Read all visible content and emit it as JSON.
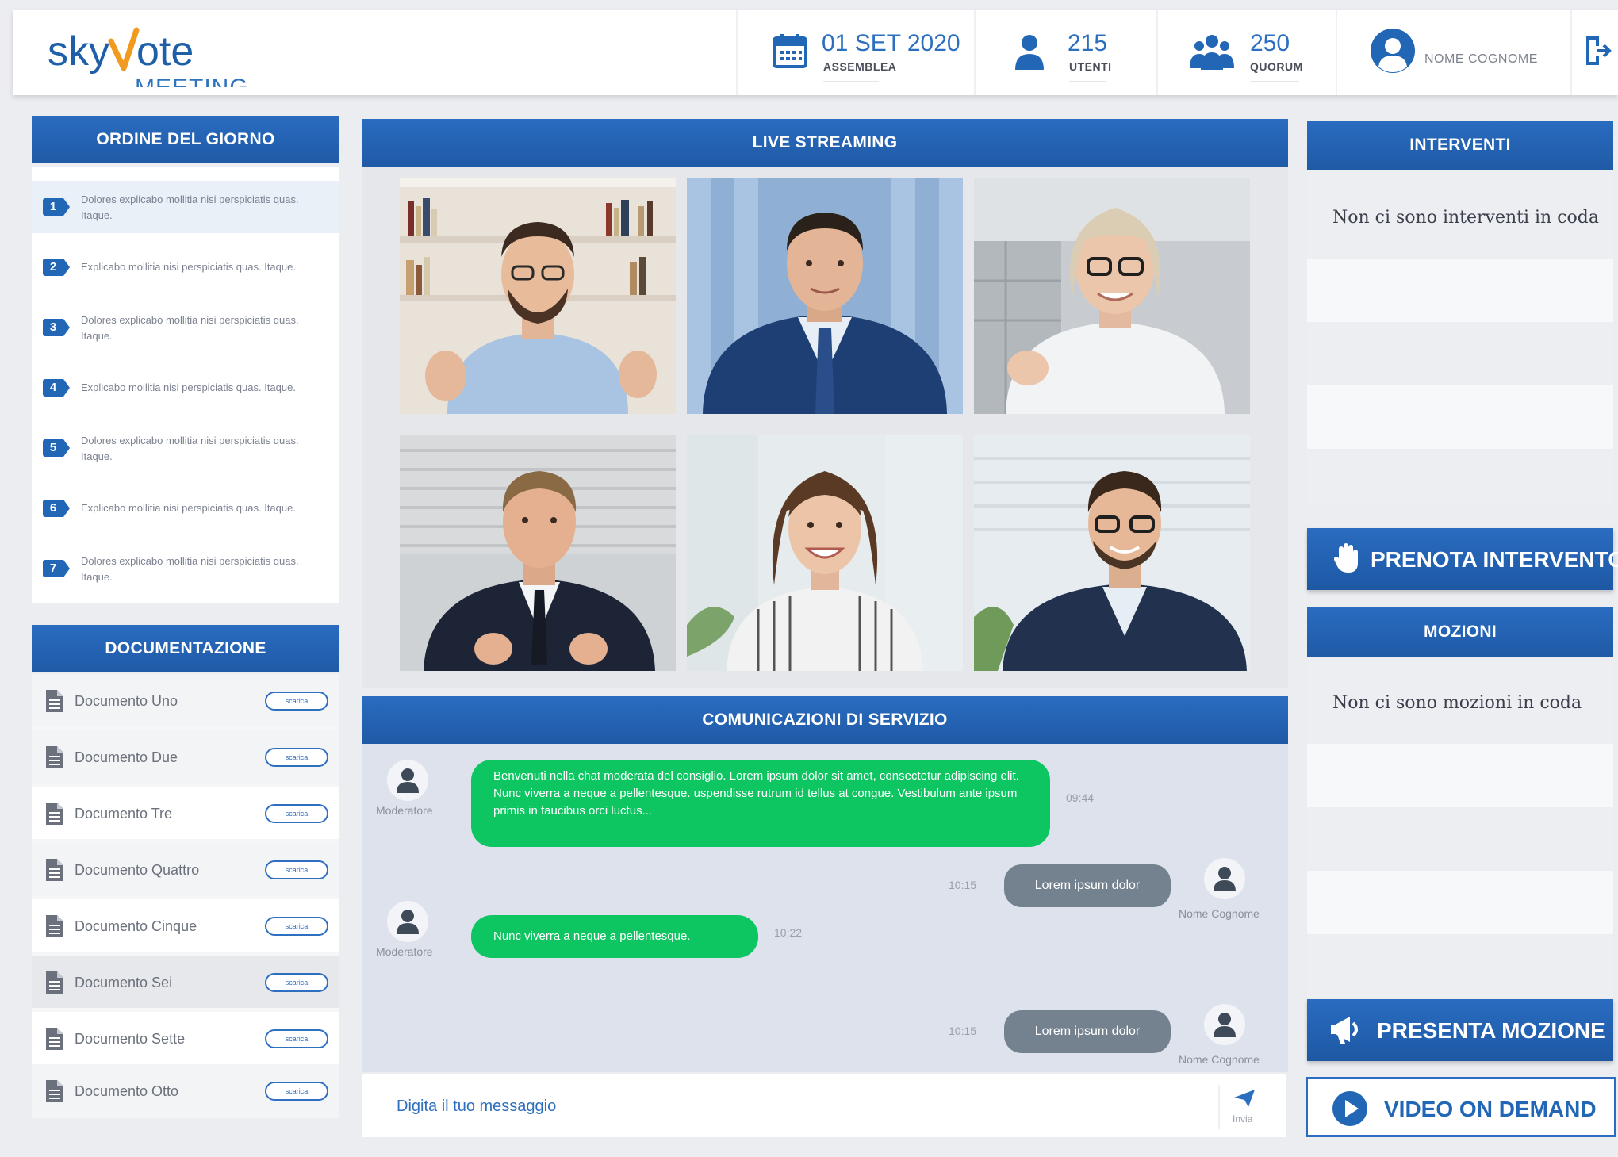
{
  "header": {
    "logo_sky": "skyvote",
    "logo_meeting": "MEETING",
    "date": {
      "value": "01 SET 2020",
      "label": "ASSEMBLEA"
    },
    "users": {
      "value": "215",
      "label": "UTENTI"
    },
    "quorum": {
      "value": "250",
      "label": "QUORUM"
    },
    "user_name": "NOME COGNOME"
  },
  "agenda": {
    "title": "ORDINE DEL GIORNO",
    "items": [
      {
        "num": "1",
        "text": "Dolores explicabo mollitia nisi perspiciatis quas. Itaque."
      },
      {
        "num": "2",
        "text": "Explicabo mollitia nisi perspiciatis quas. Itaque."
      },
      {
        "num": "3",
        "text": "Dolores explicabo mollitia nisi perspiciatis quas. Itaque."
      },
      {
        "num": "4",
        "text": "Explicabo mollitia nisi perspiciatis quas. Itaque."
      },
      {
        "num": "5",
        "text": "Dolores explicabo mollitia nisi perspiciatis quas. Itaque."
      },
      {
        "num": "6",
        "text": "Explicabo mollitia nisi perspiciatis quas. Itaque."
      },
      {
        "num": "7",
        "text": "Dolores explicabo mollitia nisi perspiciatis quas. Itaque."
      }
    ]
  },
  "docs": {
    "title": "DOCUMENTAZIONE",
    "download_label": "scarica",
    "items": [
      "Documento Uno",
      "Documento Due",
      "Documento Tre",
      "Documento Quattro",
      "Documento Cinque",
      "Documento Sei",
      "Documento Sette",
      "Documento Otto"
    ]
  },
  "streaming": {
    "title": "LIVE STREAMING"
  },
  "chat": {
    "title": "COMUNICAZIONI DI SERVIZIO",
    "messages": [
      {
        "sender": "Moderatore",
        "text": "Benvenuti nella chat moderata del consiglio. Lorem ipsum dolor sit amet, consectetur adipiscing elit. Nunc viverra a neque a pellentesque. uspendisse rutrum id tellus at congue. Vestibulum ante ipsum primis in faucibus orci luctus...",
        "time": "09:44"
      },
      {
        "sender": "Nome Cognome",
        "text": "Lorem ipsum dolor",
        "time": "10:15"
      },
      {
        "sender": "Moderatore",
        "text": "Nunc viverra a neque a pellentesque.",
        "time": "10:22"
      },
      {
        "sender": "Nome Cognome",
        "text": "Lorem ipsum dolor",
        "time": "10:15"
      }
    ],
    "input_placeholder": "Digita il tuo messaggio",
    "send_label": "Invia"
  },
  "right": {
    "interventi_title": "INTERVENTI",
    "interventi_empty": "Non ci sono interventi in coda",
    "prenota_label": "PRENOTA INTERVENTO",
    "mozioni_title": "MOZIONI",
    "mozioni_empty": "Non ci sono mozioni in coda",
    "presenta_label": "PRESENTA MOZIONE",
    "vod_label": "VIDEO ON DEMAND"
  },
  "colors": {
    "primary": "#1f5aa6",
    "chat_green": "#0dc561",
    "chat_gray": "#74818f",
    "logo_accent": "#f29a1d"
  }
}
